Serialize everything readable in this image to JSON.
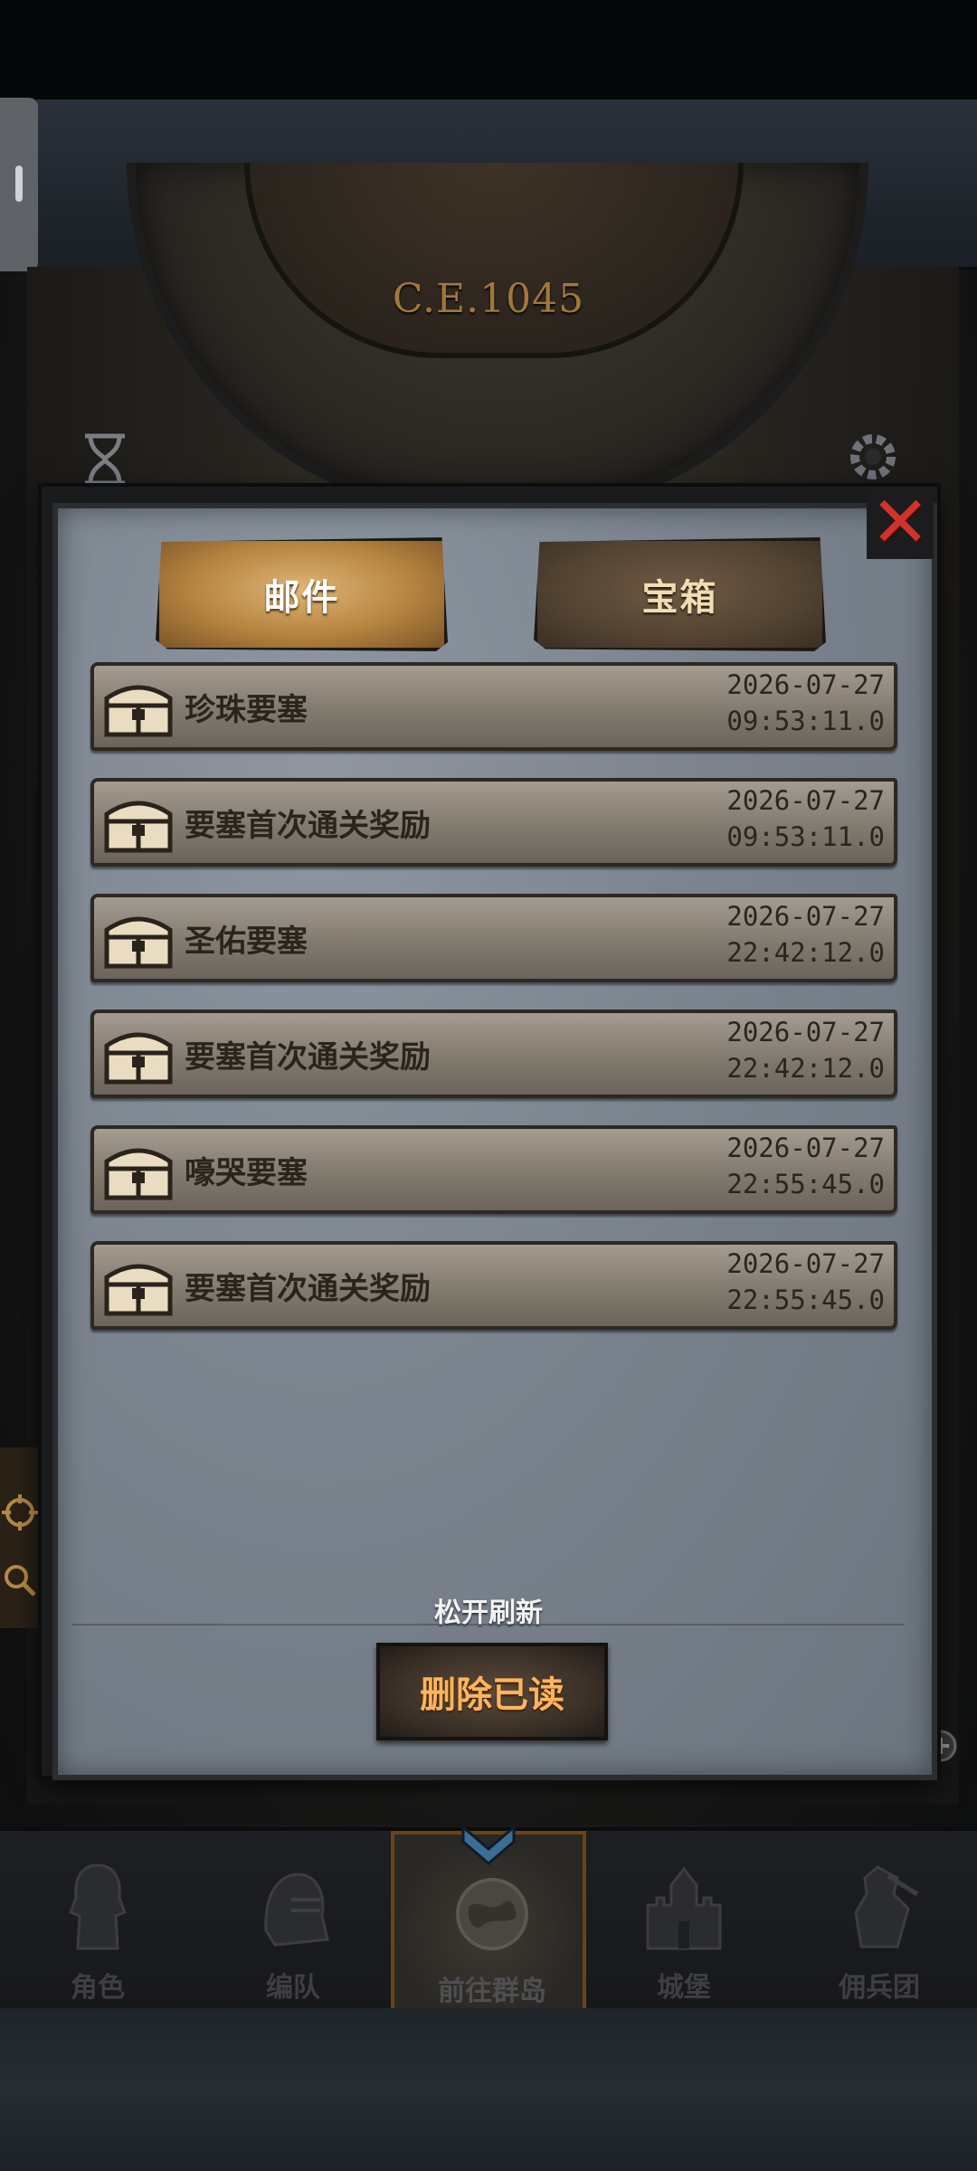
{
  "era": {
    "label": "C.E.1045"
  },
  "dialog": {
    "tabs": [
      {
        "label": "邮件",
        "active": true
      },
      {
        "label": "宝箱",
        "active": false
      }
    ],
    "mails": [
      {
        "title": "珍珠要塞",
        "date": "2026-07-27",
        "time": "09:53:11.0"
      },
      {
        "title": "要塞首次通关奖励",
        "date": "2026-07-27",
        "time": "09:53:11.0"
      },
      {
        "title": "圣佑要塞",
        "date": "2026-07-27",
        "time": "22:42:12.0"
      },
      {
        "title": "要塞首次通关奖励",
        "date": "2026-07-27",
        "time": "22:42:12.0"
      },
      {
        "title": "嚎哭要塞",
        "date": "2026-07-27",
        "time": "22:55:45.0"
      },
      {
        "title": "要塞首次通关奖励",
        "date": "2026-07-27",
        "time": "22:55:45.0"
      }
    ],
    "refresh_hint": "松开刷新",
    "delete_read_label": "删除已读"
  },
  "bottom_nav": [
    {
      "label": "角色",
      "icon": "knight-icon",
      "active": false
    },
    {
      "label": "编队",
      "icon": "helmet-icon",
      "active": false
    },
    {
      "label": "前往群岛",
      "icon": "globe-icon",
      "active": true
    },
    {
      "label": "城堡",
      "icon": "castle-icon",
      "active": false
    },
    {
      "label": "佣兵团",
      "icon": "mercenary-icon",
      "active": false
    }
  ],
  "colors": {
    "accent_gold": "#ffb45a",
    "close_red": "#d1322b",
    "tab_active": "#c99556"
  }
}
